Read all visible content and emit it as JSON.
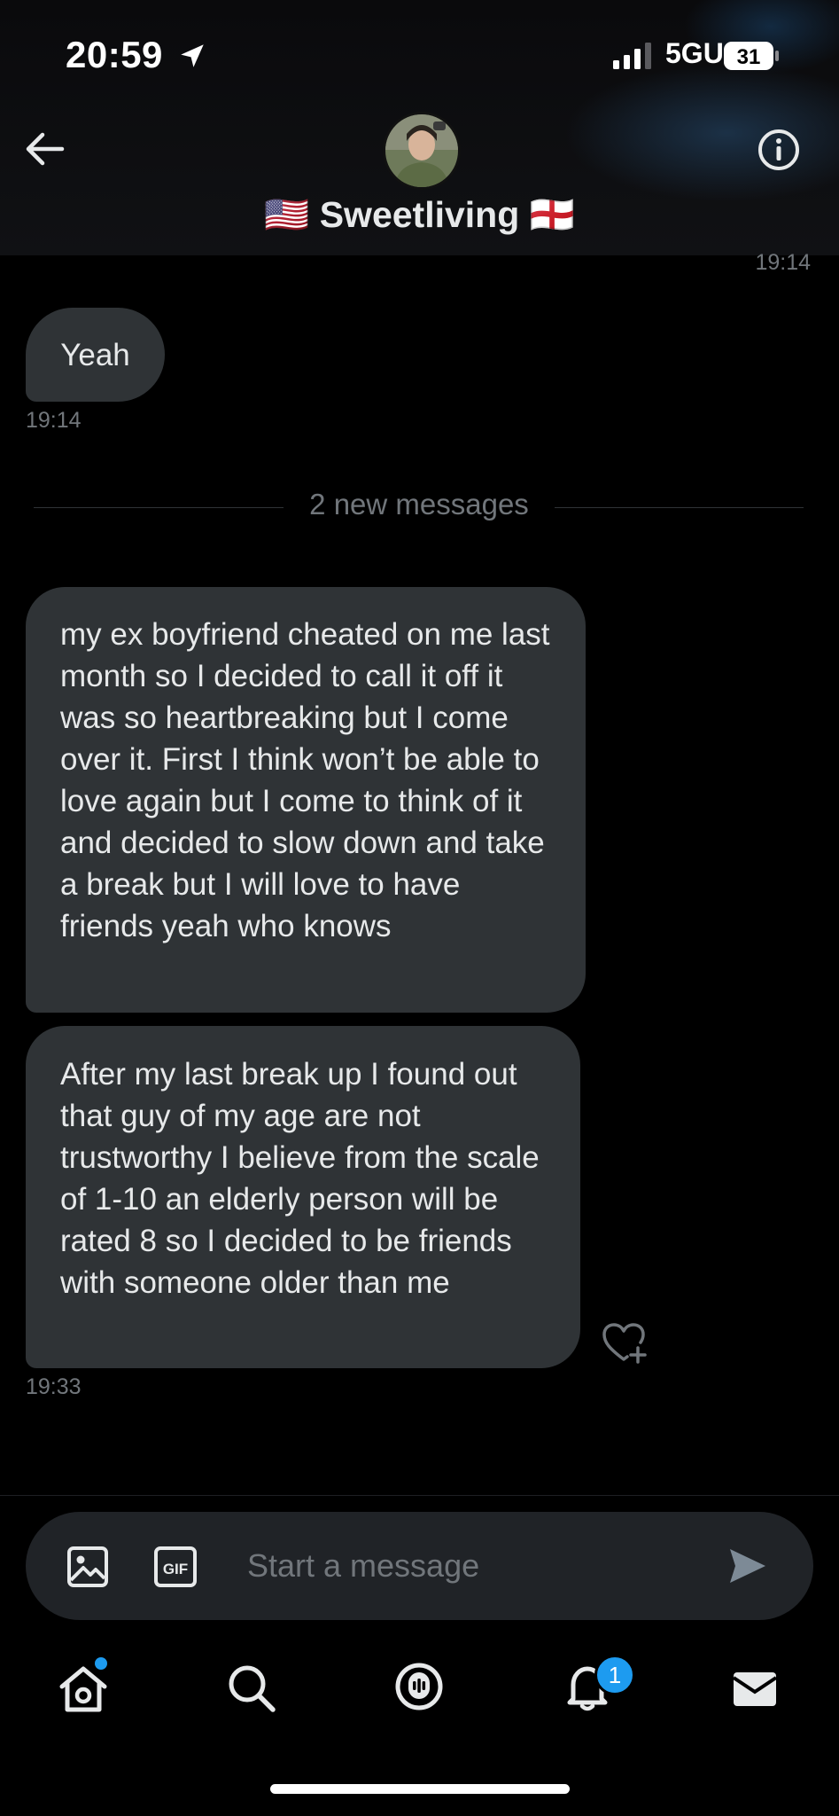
{
  "status_bar": {
    "time": "20:59",
    "network": "5GUC",
    "battery": "31"
  },
  "header": {
    "contact_name": "🇺🇸 Sweetliving 🏴󠁧󠁢󠁥󠁮󠁧󠁿"
  },
  "conversation": {
    "top_timestamp": "19:14",
    "messages": [
      {
        "text": "Yeah",
        "timestamp": "19:14"
      },
      {
        "text": "my ex boyfriend cheated on me last month so I decided to call it off it was so heartbreaking but I come over it. First I think won’t be able to love again but I come to think of it and decided to slow down and take a break but I will love to have friends yeah who knows"
      },
      {
        "text": "After my last break up I found out that guy of my age are not trustworthy I believe from the scale of 1-10 an elderly person will be rated 8 so I decided to be friends with someone older than me",
        "timestamp": "19:33"
      }
    ],
    "new_messages_divider": "2 new messages"
  },
  "composer": {
    "placeholder": "Start a message"
  },
  "tab_bar": {
    "items": [
      "home-icon",
      "search-icon",
      "spaces-icon",
      "notifications-icon",
      "messages-icon"
    ],
    "notification_count": "1"
  },
  "colors": {
    "accent": "#1d9bf0",
    "bubble": "#2f3336",
    "muted": "#71767b"
  }
}
